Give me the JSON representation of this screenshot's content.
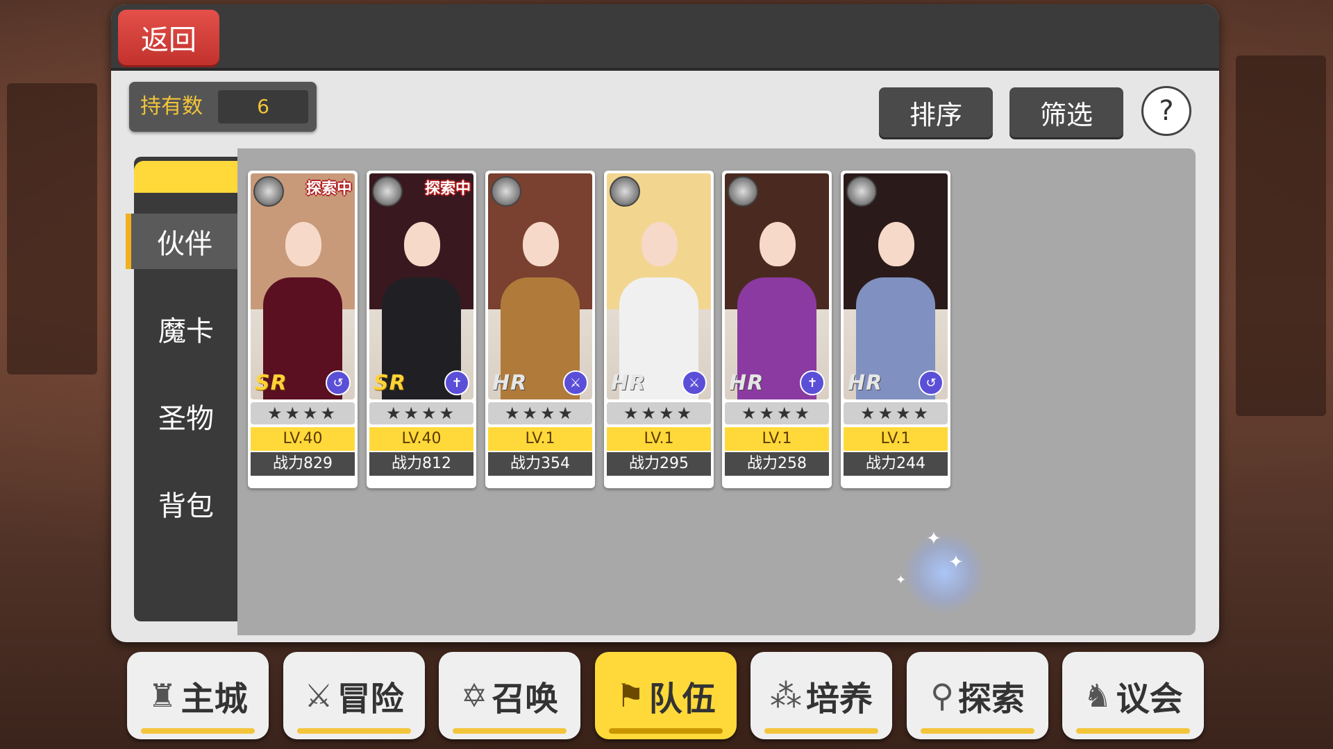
{
  "header": {
    "back_label": "返回"
  },
  "owned": {
    "label": "持有数",
    "value": "6"
  },
  "toolbar": {
    "sort_label": "排序",
    "filter_label": "筛选",
    "help_label": "?"
  },
  "side_tabs": [
    "伙伴",
    "魔卡",
    "圣物",
    "背包"
  ],
  "cards": [
    {
      "tag": "探索中",
      "rarity": "SR",
      "element_icon": "spiral-icon",
      "element_glyph": "↺",
      "stars": "★★★★",
      "level": "LV.40",
      "power": "战力829",
      "hair": "#c89a7a",
      "outfit": "#5a1020"
    },
    {
      "tag": "探索中",
      "rarity": "SR",
      "element_icon": "cross-icon",
      "element_glyph": "✝",
      "stars": "★★★★",
      "level": "LV.40",
      "power": "战力812",
      "hair": "#3a1820",
      "outfit": "#202024"
    },
    {
      "tag": "",
      "rarity": "HR",
      "element_icon": "sword-icon",
      "element_glyph": "⚔",
      "stars": "★★★★",
      "level": "LV.1",
      "power": "战力354",
      "hair": "#7a4030",
      "outfit": "#b07a3a"
    },
    {
      "tag": "",
      "rarity": "HR",
      "element_icon": "sword-icon",
      "element_glyph": "⚔",
      "stars": "★★★★",
      "level": "LV.1",
      "power": "战力295",
      "hair": "#f2d690",
      "outfit": "#f0f0f0"
    },
    {
      "tag": "",
      "rarity": "HR",
      "element_icon": "cross-icon",
      "element_glyph": "✝",
      "stars": "★★★★",
      "level": "LV.1",
      "power": "战力258",
      "hair": "#4a2a20",
      "outfit": "#8a3aa0"
    },
    {
      "tag": "",
      "rarity": "HR",
      "element_icon": "spiral-icon",
      "element_glyph": "↺",
      "stars": "★★★★",
      "level": "LV.1",
      "power": "战力244",
      "hair": "#2a1a1a",
      "outfit": "#8090c0"
    }
  ],
  "bottom_nav": [
    {
      "label": "主城",
      "icon": "castle-icon",
      "glyph": "♜"
    },
    {
      "label": "冒险",
      "icon": "crossed-swords-icon",
      "glyph": "⚔"
    },
    {
      "label": "召唤",
      "icon": "hexagram-icon",
      "glyph": "✡"
    },
    {
      "label": "队伍",
      "icon": "team-icon",
      "glyph": "⚑"
    },
    {
      "label": "培养",
      "icon": "nurture-icon",
      "glyph": "⁂"
    },
    {
      "label": "探索",
      "icon": "explore-icon",
      "glyph": "⚲"
    },
    {
      "label": "议会",
      "icon": "council-icon",
      "glyph": "♞"
    }
  ],
  "active_nav": "队伍",
  "colors": {
    "accent": "#ffd93a",
    "back_button": "#d8403b",
    "panel": "#e6e6e6"
  }
}
